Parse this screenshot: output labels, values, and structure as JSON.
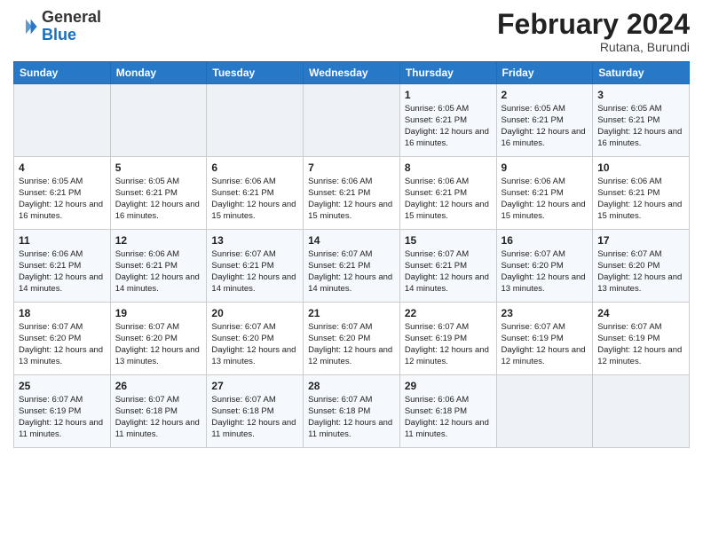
{
  "header": {
    "logo_line1": "General",
    "logo_line2": "Blue",
    "month": "February 2024",
    "location": "Rutana, Burundi"
  },
  "days_of_week": [
    "Sunday",
    "Monday",
    "Tuesday",
    "Wednesday",
    "Thursday",
    "Friday",
    "Saturday"
  ],
  "weeks": [
    [
      {
        "day": "",
        "info": ""
      },
      {
        "day": "",
        "info": ""
      },
      {
        "day": "",
        "info": ""
      },
      {
        "day": "",
        "info": ""
      },
      {
        "day": "1",
        "info": "Sunrise: 6:05 AM\nSunset: 6:21 PM\nDaylight: 12 hours and 16 minutes."
      },
      {
        "day": "2",
        "info": "Sunrise: 6:05 AM\nSunset: 6:21 PM\nDaylight: 12 hours and 16 minutes."
      },
      {
        "day": "3",
        "info": "Sunrise: 6:05 AM\nSunset: 6:21 PM\nDaylight: 12 hours and 16 minutes."
      }
    ],
    [
      {
        "day": "4",
        "info": "Sunrise: 6:05 AM\nSunset: 6:21 PM\nDaylight: 12 hours and 16 minutes."
      },
      {
        "day": "5",
        "info": "Sunrise: 6:05 AM\nSunset: 6:21 PM\nDaylight: 12 hours and 16 minutes."
      },
      {
        "day": "6",
        "info": "Sunrise: 6:06 AM\nSunset: 6:21 PM\nDaylight: 12 hours and 15 minutes."
      },
      {
        "day": "7",
        "info": "Sunrise: 6:06 AM\nSunset: 6:21 PM\nDaylight: 12 hours and 15 minutes."
      },
      {
        "day": "8",
        "info": "Sunrise: 6:06 AM\nSunset: 6:21 PM\nDaylight: 12 hours and 15 minutes."
      },
      {
        "day": "9",
        "info": "Sunrise: 6:06 AM\nSunset: 6:21 PM\nDaylight: 12 hours and 15 minutes."
      },
      {
        "day": "10",
        "info": "Sunrise: 6:06 AM\nSunset: 6:21 PM\nDaylight: 12 hours and 15 minutes."
      }
    ],
    [
      {
        "day": "11",
        "info": "Sunrise: 6:06 AM\nSunset: 6:21 PM\nDaylight: 12 hours and 14 minutes."
      },
      {
        "day": "12",
        "info": "Sunrise: 6:06 AM\nSunset: 6:21 PM\nDaylight: 12 hours and 14 minutes."
      },
      {
        "day": "13",
        "info": "Sunrise: 6:07 AM\nSunset: 6:21 PM\nDaylight: 12 hours and 14 minutes."
      },
      {
        "day": "14",
        "info": "Sunrise: 6:07 AM\nSunset: 6:21 PM\nDaylight: 12 hours and 14 minutes."
      },
      {
        "day": "15",
        "info": "Sunrise: 6:07 AM\nSunset: 6:21 PM\nDaylight: 12 hours and 14 minutes."
      },
      {
        "day": "16",
        "info": "Sunrise: 6:07 AM\nSunset: 6:20 PM\nDaylight: 12 hours and 13 minutes."
      },
      {
        "day": "17",
        "info": "Sunrise: 6:07 AM\nSunset: 6:20 PM\nDaylight: 12 hours and 13 minutes."
      }
    ],
    [
      {
        "day": "18",
        "info": "Sunrise: 6:07 AM\nSunset: 6:20 PM\nDaylight: 12 hours and 13 minutes."
      },
      {
        "day": "19",
        "info": "Sunrise: 6:07 AM\nSunset: 6:20 PM\nDaylight: 12 hours and 13 minutes."
      },
      {
        "day": "20",
        "info": "Sunrise: 6:07 AM\nSunset: 6:20 PM\nDaylight: 12 hours and 13 minutes."
      },
      {
        "day": "21",
        "info": "Sunrise: 6:07 AM\nSunset: 6:20 PM\nDaylight: 12 hours and 12 minutes."
      },
      {
        "day": "22",
        "info": "Sunrise: 6:07 AM\nSunset: 6:19 PM\nDaylight: 12 hours and 12 minutes."
      },
      {
        "day": "23",
        "info": "Sunrise: 6:07 AM\nSunset: 6:19 PM\nDaylight: 12 hours and 12 minutes."
      },
      {
        "day": "24",
        "info": "Sunrise: 6:07 AM\nSunset: 6:19 PM\nDaylight: 12 hours and 12 minutes."
      }
    ],
    [
      {
        "day": "25",
        "info": "Sunrise: 6:07 AM\nSunset: 6:19 PM\nDaylight: 12 hours and 11 minutes."
      },
      {
        "day": "26",
        "info": "Sunrise: 6:07 AM\nSunset: 6:18 PM\nDaylight: 12 hours and 11 minutes."
      },
      {
        "day": "27",
        "info": "Sunrise: 6:07 AM\nSunset: 6:18 PM\nDaylight: 12 hours and 11 minutes."
      },
      {
        "day": "28",
        "info": "Sunrise: 6:07 AM\nSunset: 6:18 PM\nDaylight: 12 hours and 11 minutes."
      },
      {
        "day": "29",
        "info": "Sunrise: 6:06 AM\nSunset: 6:18 PM\nDaylight: 12 hours and 11 minutes."
      },
      {
        "day": "",
        "info": ""
      },
      {
        "day": "",
        "info": ""
      }
    ]
  ]
}
